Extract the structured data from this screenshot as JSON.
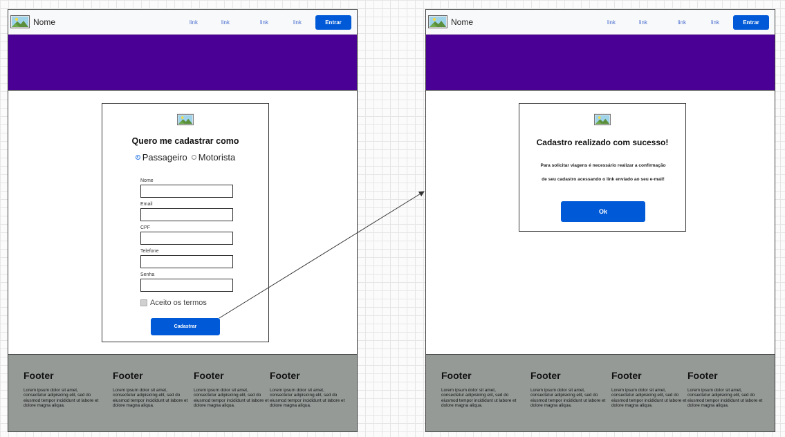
{
  "left_screen": {
    "navbar": {
      "brand_name": "Nome",
      "links": [
        "link",
        "link",
        "link",
        "link"
      ],
      "enter_label": "Entrar"
    },
    "form": {
      "title": "Quero me cadastrar como",
      "radio_options": [
        {
          "label": "Passageiro",
          "selected": true
        },
        {
          "label": "Motorista",
          "selected": false
        }
      ],
      "fields": [
        {
          "label": "Nome",
          "value": ""
        },
        {
          "label": "Email",
          "value": ""
        },
        {
          "label": "CPF",
          "value": ""
        },
        {
          "label": "Telefone",
          "value": ""
        },
        {
          "label": "Senha",
          "value": ""
        }
      ],
      "terms_label": "Aceito os termos",
      "terms_checked": false,
      "submit_label": "Cadastrar"
    },
    "footer": {
      "columns": [
        {
          "title": "Footer",
          "text": "Lorem ipsum dolor sit amet, consectetur adipisicing elit, sed do eiusmod tempor incididunt ut labore et dolore magna aliqua."
        },
        {
          "title": "Footer",
          "text": "Lorem ipsum dolor sit amet, consectetur adipisicing elit, sed do eiusmod tempor incididunt ut labore et dolore magna aliqua."
        },
        {
          "title": "Footer",
          "text": "Lorem ipsum dolor sit amet, consectetur adipisicing elit, sed do eiusmod tempor incididunt ut labore et dolore magna aliqua."
        },
        {
          "title": "Footer",
          "text": "Lorem ipsum dolor sit amet, consectetur adipisicing elit, sed do eiusmod tempor incididunt ut labore et dolore magna aliqua."
        }
      ]
    }
  },
  "right_screen": {
    "navbar": {
      "brand_name": "Nome",
      "links": [
        "link",
        "link",
        "link",
        "link"
      ],
      "enter_label": "Entrar"
    },
    "success": {
      "title": "Cadastro realizado com sucesso!",
      "message_line1": "Para solicitar viagens é necessário realizar a confirmação",
      "message_line2": "de seu cadastro acessando o link enviado ao seu e-mail!",
      "ok_label": "Ok"
    },
    "footer": {
      "columns": [
        {
          "title": "Footer",
          "text": "Lorem ipsum dolor sit amet, consectetur adipisicing elit, sed do eiusmod tempor incididunt ut labore et dolore magna aliqua."
        },
        {
          "title": "Footer",
          "text": "Lorem ipsum dolor sit amet, consectetur adipisicing elit, sed do eiusmod tempor incididunt ut labore et dolore magna aliqua."
        },
        {
          "title": "Footer",
          "text": "Lorem ipsum dolor sit amet, consectetur adipisicing elit, sed do eiusmod tempor incididunt ut labore et dolore magna aliqua."
        },
        {
          "title": "Footer",
          "text": "Lorem ipsum dolor sit amet, consectetur adipisicing elit, sed do eiusmod tempor incididunt ut labore et dolore magna aliqua."
        }
      ]
    }
  },
  "colors": {
    "hero": "#4b0095",
    "primary_button": "#0059d6",
    "footer_bg": "#959a97",
    "nav_link": "#4a6fd0"
  },
  "icons": {
    "brand": "image-placeholder-icon",
    "card": "image-placeholder-icon"
  }
}
